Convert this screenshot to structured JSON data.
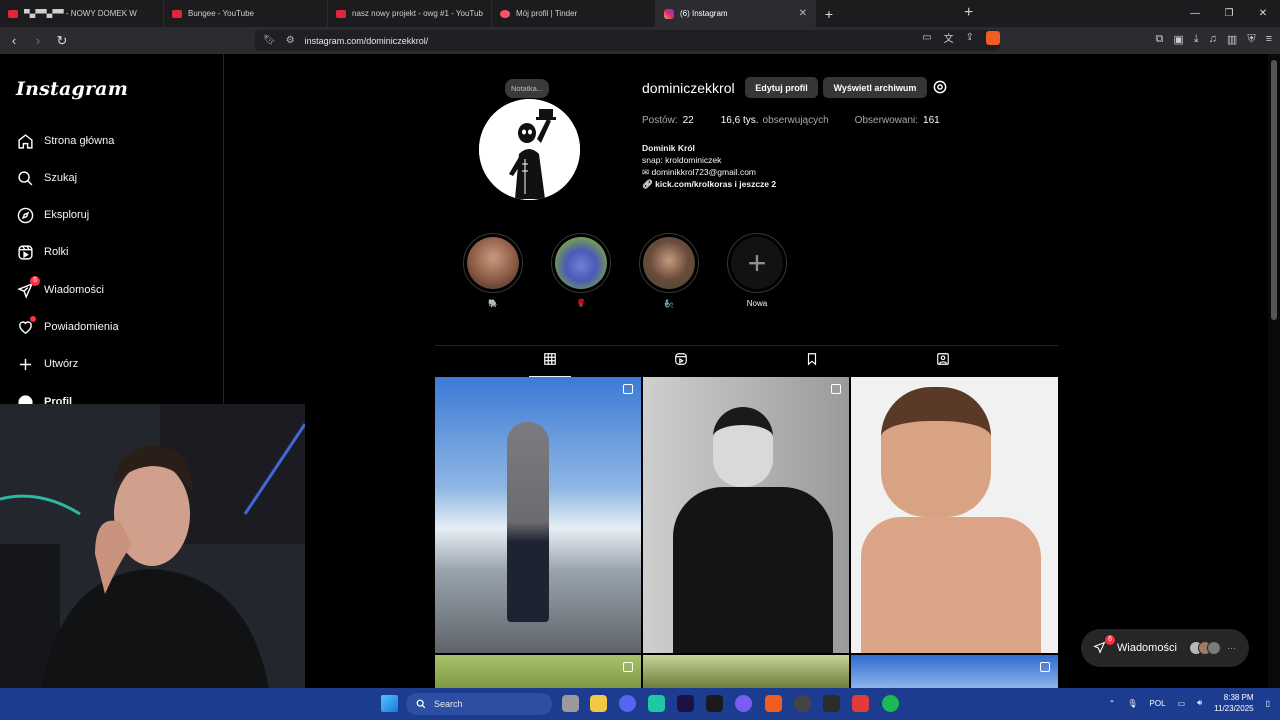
{
  "browser": {
    "tabs": [
      {
        "title": "▀▄▀▀▄▀▀ - NOWY DOMEK W",
        "favicon": "youtube-icon",
        "active": false
      },
      {
        "title": "Bungee - YouTube",
        "favicon": "youtube-icon",
        "active": false
      },
      {
        "title": "nasz nowy projekt - owg #1 - YouTub",
        "favicon": "youtube-icon",
        "active": false
      },
      {
        "title": "Mój profil | Tinder",
        "favicon": "tinder-icon",
        "active": false
      },
      {
        "title": "(6) Instagram",
        "favicon": "instagram-icon",
        "active": true
      }
    ],
    "url": "instagram.com/dominiczekkrol/"
  },
  "sidebar": {
    "logo": "Instagram",
    "items": [
      {
        "label": "Strona główna",
        "icon": "home-icon"
      },
      {
        "label": "Szukaj",
        "icon": "search-icon"
      },
      {
        "label": "Eksploruj",
        "icon": "compass-icon"
      },
      {
        "label": "Rolki",
        "icon": "reels-icon"
      },
      {
        "label": "Wiadomości",
        "icon": "messenger-icon",
        "badge": "6"
      },
      {
        "label": "Powiadomienia",
        "icon": "heart-icon"
      },
      {
        "label": "Utwórz",
        "icon": "plus-icon"
      },
      {
        "label": "Profil",
        "icon": "profile-icon"
      }
    ]
  },
  "profile": {
    "note": "Notatka...",
    "username": "dominiczekkrol",
    "edit_button": "Edytuj profil",
    "archive_button": "Wyświetl archiwum",
    "posts_label": "Postów:",
    "posts_count": "22",
    "followers_count": "16,6 tys.",
    "followers_label": "obserwujących",
    "following_label": "Obserwowani:",
    "following_count": "161",
    "full_name": "Dominik Król",
    "bio_line1": "snap: kroldominiczek",
    "bio_email": "dominikkrol723@gmail.com",
    "bio_link": "kick.com/krolkoras i jeszcze 2"
  },
  "highlights": [
    {
      "label": "🐘"
    },
    {
      "label": "🌹"
    },
    {
      "label": "🧞"
    },
    {
      "label": "Nowa"
    }
  ],
  "messages_pill": {
    "label": "Wiadomości",
    "badge": "6",
    "more": "···"
  },
  "taskbar": {
    "search": "Search",
    "language": "POL",
    "time": "8:38 PM",
    "date": "11/23/2025"
  }
}
